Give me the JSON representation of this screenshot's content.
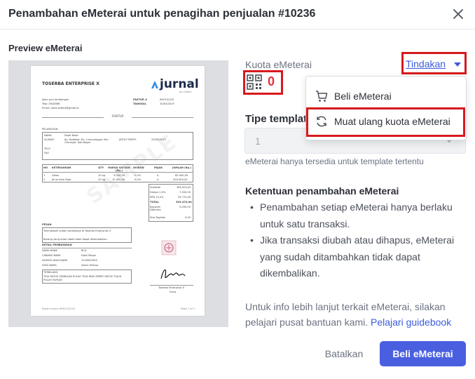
{
  "modal": {
    "title": "Penambahan eMeterai untuk penagihan penjualan #10236"
  },
  "preview": {
    "label": "Preview eMeterai",
    "invoice": {
      "company": "TOSERBA ENTERPRISE X",
      "logo": "jurnal",
      "logo_sub": "by mekari",
      "address_lines": [
        "Jalan puri lembangan",
        "Telp: 0618566",
        "Email: darla.selena@gmail.id"
      ],
      "faktur_no_label": "FAKTUR #",
      "faktur_no": "INV/10/103",
      "tanggal_label": "TANGGAL",
      "tanggal": "20/04/2019",
      "faktur_title": "FAKTUR",
      "pelanggan_label": "PELANGGAN",
      "nama_label": "NAMA",
      "nama": "Dojet Nasir",
      "alamat_label": "ALAMAT",
      "alamat": "Kp. Babakan Ds. Lulumanggal, Kec. Cileungsi, Kab.Bogor",
      "telp_label": "TELP",
      "fax_label": "FAX",
      "jatuh_tempo_label": "JATUH TEMPO",
      "jatuh_tempo": "25/06/2019",
      "table_headers": [
        "NO",
        "KETERANGAN",
        "QTY",
        "HARGA SATUAN (Rp.)",
        "DISKON",
        "PAJAK",
        "JUMLAH (Rp.)"
      ],
      "rows": [
        [
          "1",
          "Gelas",
          "10 kg",
          "5.000,00",
          "0,0%",
          "A",
          "65.000,00"
        ],
        [
          "2",
          "Jeruk Kam Raja",
          "20 kg",
          "15.000,00",
          "0,0%",
          "A",
          "300.000,00"
        ]
      ],
      "summary": [
        [
          "Subtotal",
          "365.000,00"
        ],
        [
          "Diskon 2,0%",
          "7.300,00"
        ],
        [
          "PPN 10,0%",
          "35.770,00"
        ],
        [
          "TOTAL",
          "393.470,00"
        ],
        [
          "Bayaran Diterima",
          "3.000,00"
        ],
        [
          "Sisa Tagihan",
          "0,00"
        ]
      ],
      "watermark": "SAMPLE",
      "pesan_label": "PESAN",
      "pesan_lines": [
        "Terimakasih sudah berbelanja di Toserba Enterprise X",
        "Barang yang telah dibeli tidak dapat dikembalikan"
      ],
      "bank_label": "DETAIL PEMBAYARAN",
      "bank_rows": [
        [
          "NAMA BANK",
          "BCA"
        ],
        [
          "CABANG BANK",
          "Dawi Mogol"
        ],
        [
          "NOMOR AKUN BANK",
          "1234567890"
        ],
        [
          "ATAS NAMA",
          "Dania Helena"
        ]
      ],
      "terbilang_label": "TERBILANG",
      "terbilang": "TIGA RATUS SEMBILAN PULUH TIGA RIBU EMPAT RATUS TUJUH PULUH RUPIAH",
      "signer": "Toserba Enterprise X",
      "signer_sub": "Irana",
      "footer_left": "Baba Invoice #INV/10/102",
      "footer_right": "Page 1 of 1"
    }
  },
  "kuota": {
    "label": "Kuota eMeterai",
    "value": "0",
    "icon": "qr-code-icon"
  },
  "tindakan": {
    "label": "Tindakan"
  },
  "dropdown": {
    "items": [
      {
        "label": "Beli eMeterai",
        "icon": "cart-icon"
      },
      {
        "label": "Muat ulang kuota eMeterai",
        "icon": "refresh-icon"
      }
    ]
  },
  "tipe_template": {
    "label": "Tipe template",
    "value": "1",
    "note": "eMeterai hanya tersedia untuk template tertentu"
  },
  "ketentuan": {
    "title": "Ketentuan penambahan eMeterai",
    "items": [
      "Penambahan setiap eMeterai hanya berlaku untuk satu transaksi.",
      "Jika transaksi diubah atau dihapus, eMeterai yang sudah ditambahkan tidak dapat dikembalikan."
    ]
  },
  "info": {
    "text": "Untuk info lebih lanjut terkait eMeterai, silakan pelajari pusat bantuan kami.",
    "link": "Pelajari guidebook"
  },
  "footer": {
    "cancel": "Batalkan",
    "buy": "Beli eMeterai"
  },
  "colors": {
    "accent": "#4a5fe0",
    "link": "#3b5bdb",
    "highlight": "#d7191d",
    "quota_zero": "#e5323a"
  }
}
